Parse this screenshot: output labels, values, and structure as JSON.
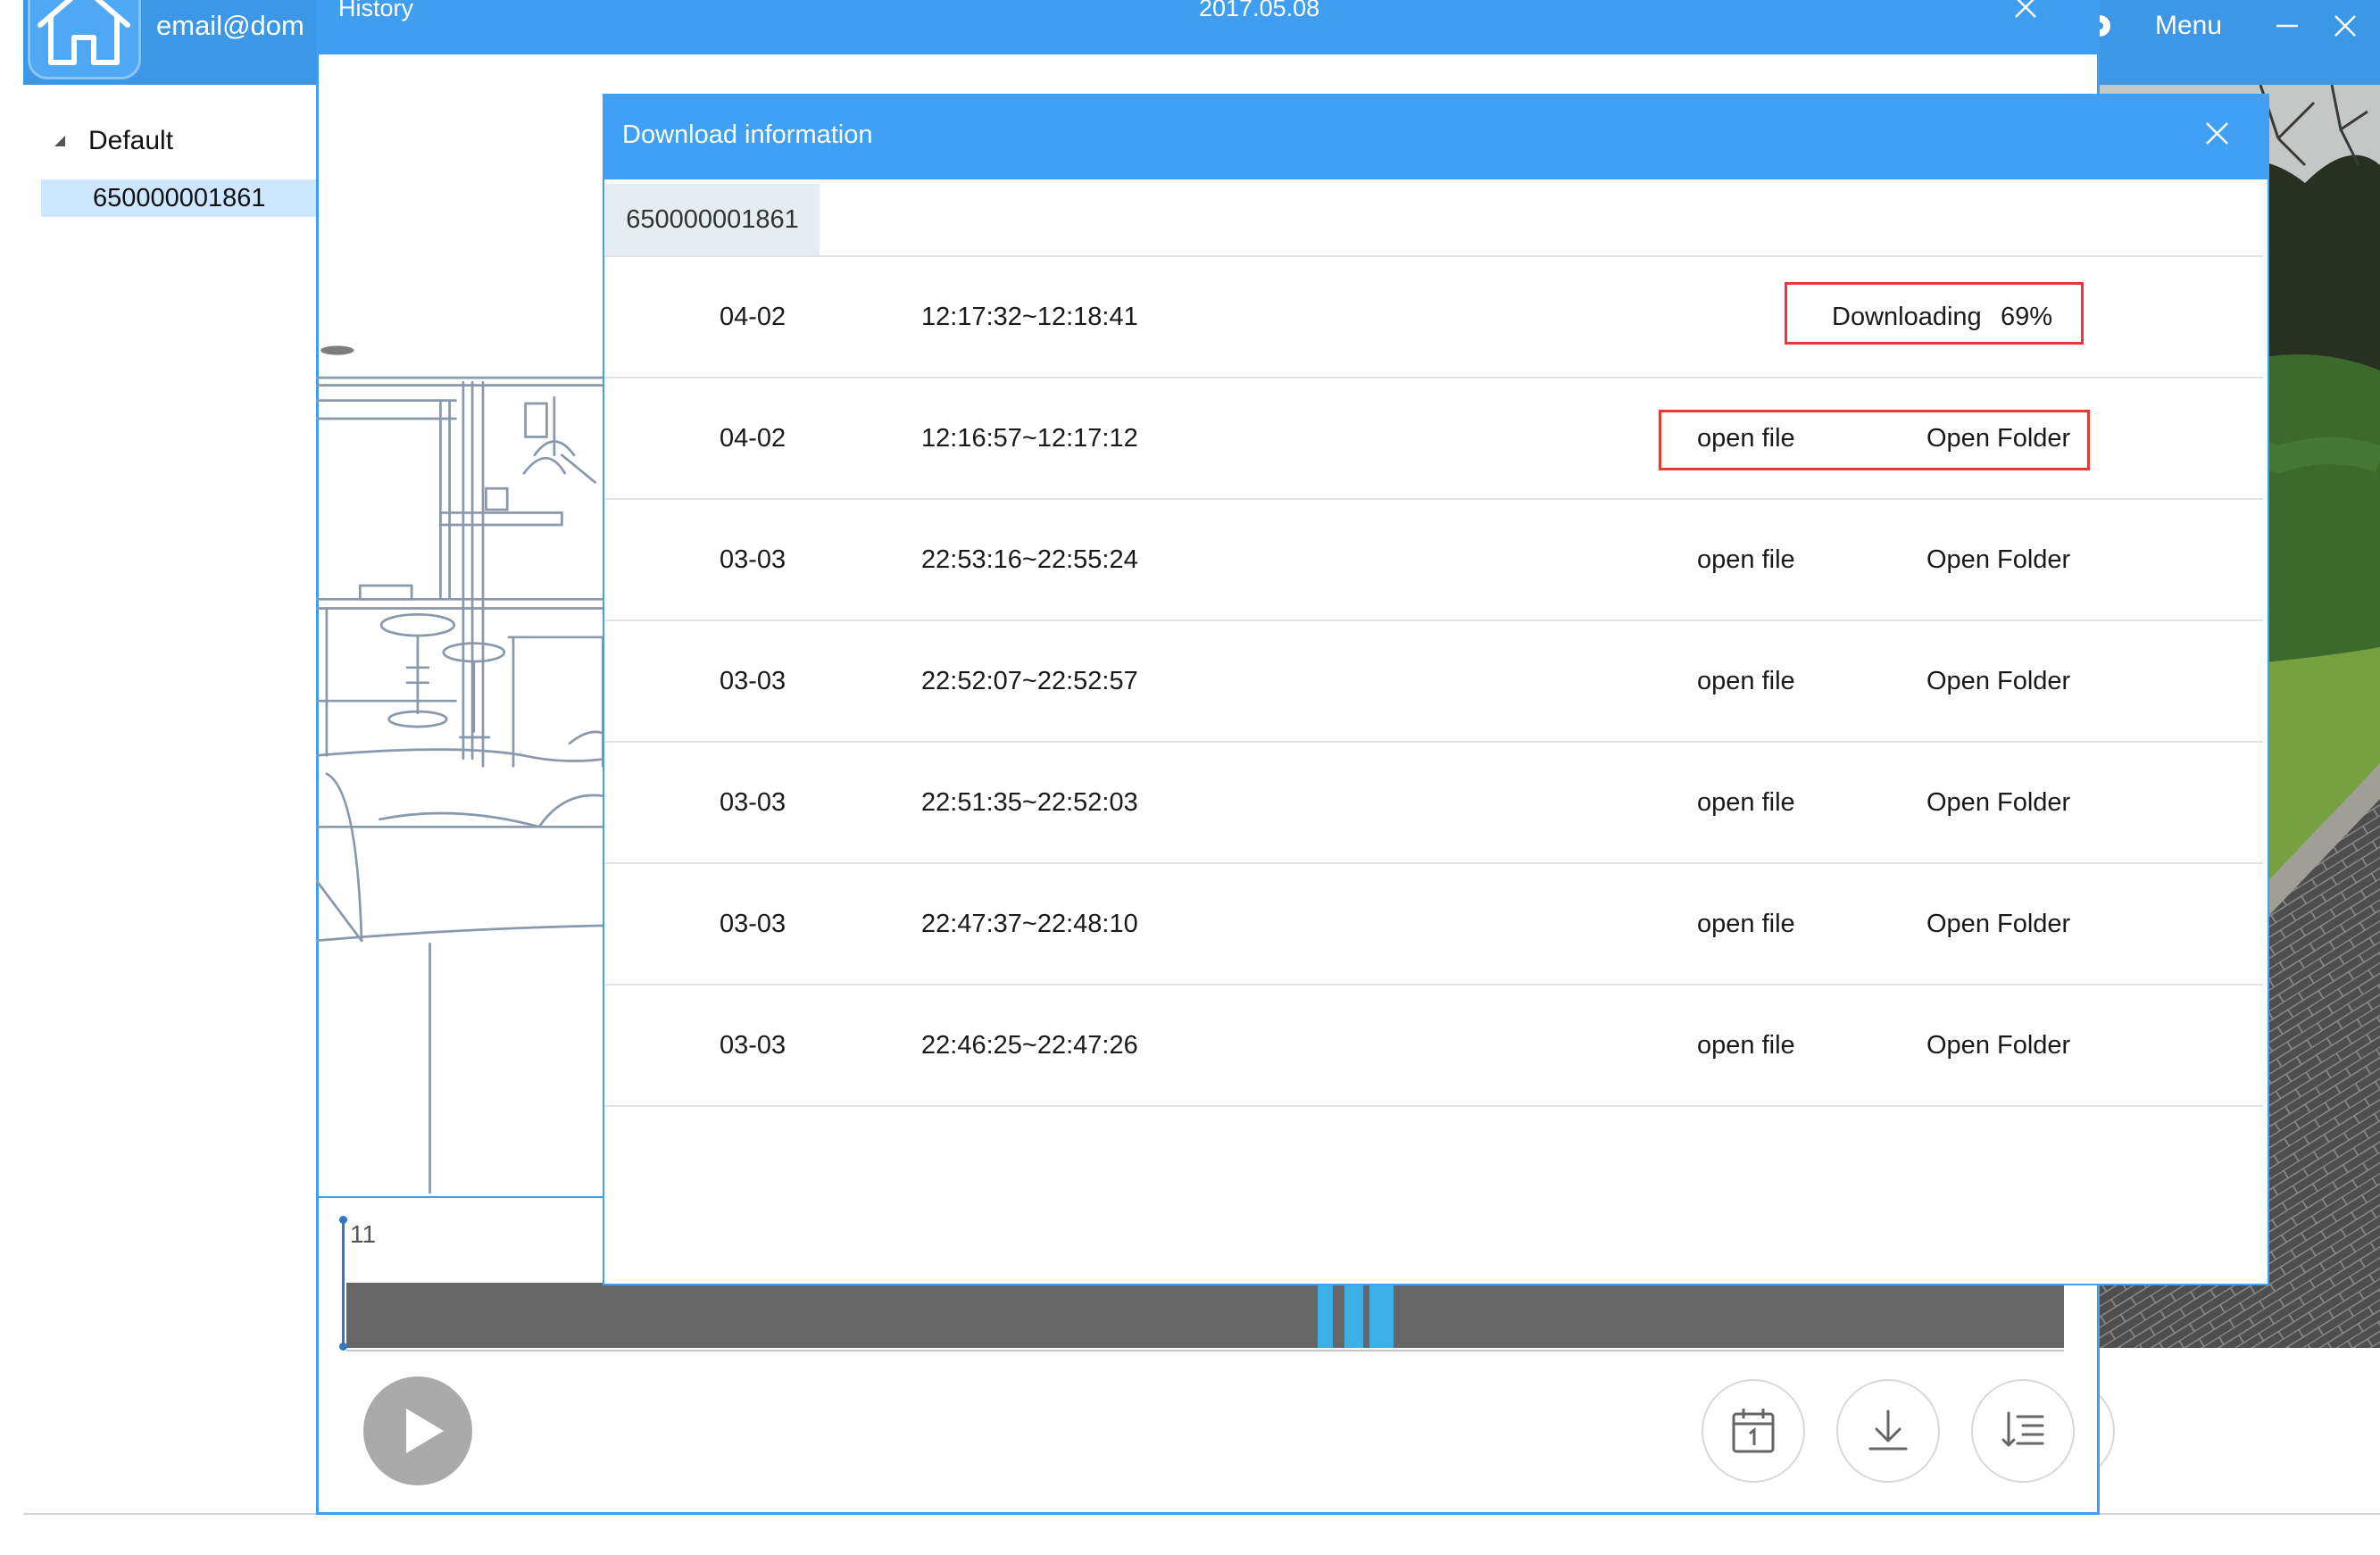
{
  "app": {
    "user_email": "email@dom",
    "menu_label": "Menu"
  },
  "sidebar": {
    "group_label": "Default",
    "group_expanded": true,
    "devices": [
      {
        "label": "650000001861",
        "selected": true
      }
    ]
  },
  "history": {
    "title": "History",
    "date": "2017.05.08",
    "timeline_label": "11"
  },
  "download_dialog": {
    "title": "Download information",
    "tab": "650000001861",
    "rows": [
      {
        "date": "04-02",
        "time": "12:17:32~12:18:41",
        "status": "Downloading",
        "progress": "69%",
        "highlighted": true
      },
      {
        "date": "04-02",
        "time": "12:16:57~12:17:12",
        "open_file": "open file",
        "open_folder": "Open Folder",
        "highlighted": true
      },
      {
        "date": "03-03",
        "time": "22:53:16~22:55:24",
        "open_file": "open file",
        "open_folder": "Open Folder",
        "highlighted": false
      },
      {
        "date": "03-03",
        "time": "22:52:07~22:52:57",
        "open_file": "open file",
        "open_folder": "Open Folder",
        "highlighted": false
      },
      {
        "date": "03-03",
        "time": "22:51:35~22:52:03",
        "open_file": "open file",
        "open_folder": "Open Folder",
        "highlighted": false
      },
      {
        "date": "03-03",
        "time": "22:47:37~22:48:10",
        "open_file": "open file",
        "open_folder": "Open Folder",
        "highlighted": false
      },
      {
        "date": "03-03",
        "time": "22:46:25~22:47:26",
        "open_file": "open file",
        "open_folder": "Open Folder",
        "highlighted": false
      }
    ]
  },
  "icons": {
    "home": "home-icon",
    "menu": "menu-icon",
    "minimize": "minimize-icon",
    "close": "close-icon",
    "group_toggle": "triangle-down-icon",
    "play": "play-icon",
    "calendar": "calendar-icon",
    "download": "download-icon",
    "list": "list-icon"
  },
  "colors": {
    "header": "#3c97e6",
    "accent": "#3fa0f5",
    "highlight": "#e53935",
    "selected_item": "#cce7ff",
    "timeline_track": "#666666",
    "recording_segment": "#3cb0e6"
  }
}
